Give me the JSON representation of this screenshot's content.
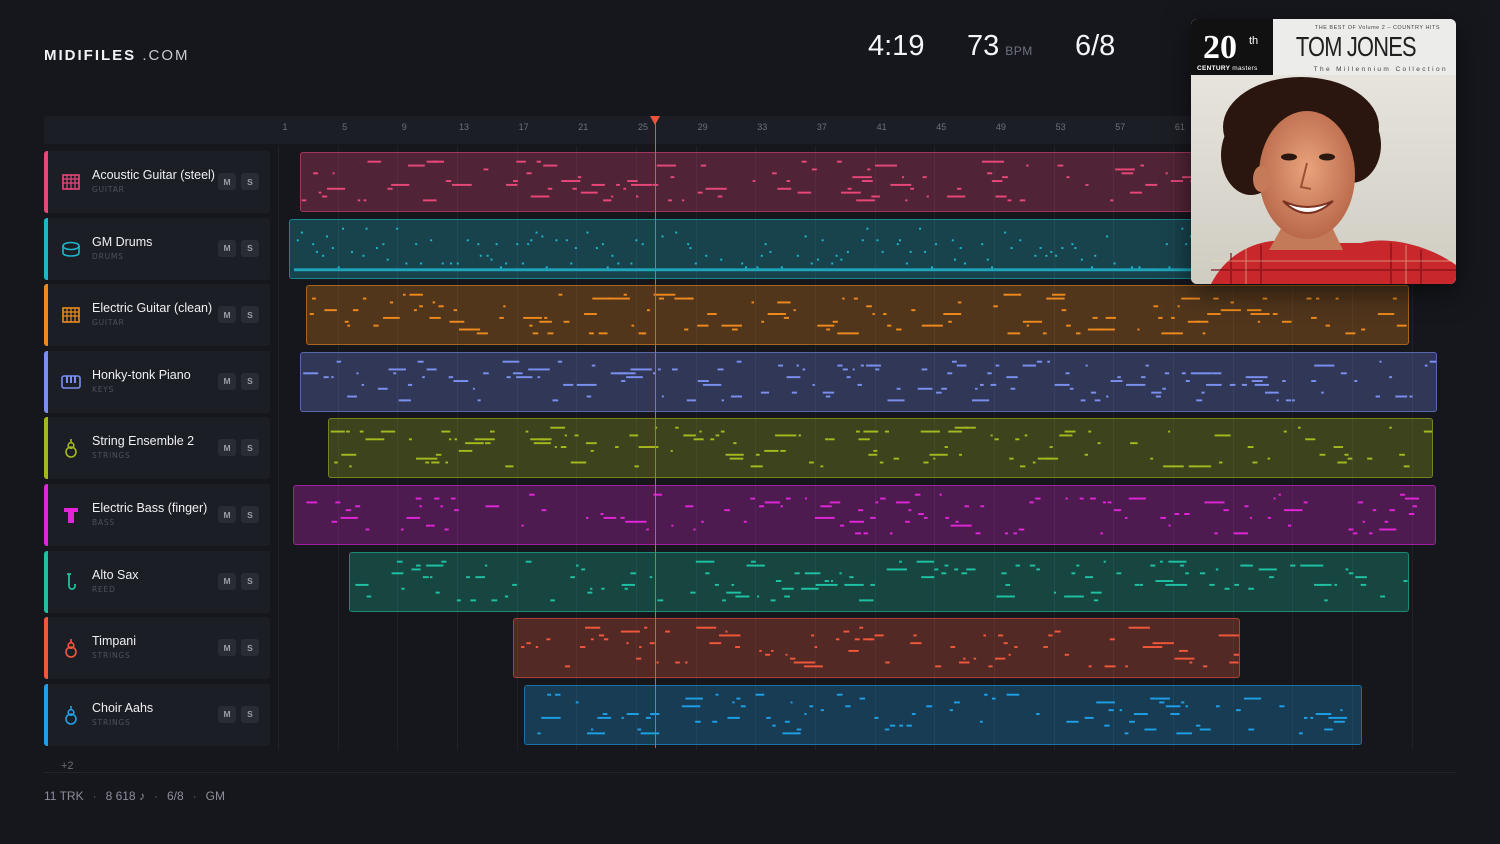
{
  "brand": {
    "main": "MIDIFILES",
    "suffix": ".COM"
  },
  "stats": {
    "time": "4:19",
    "tempo": "73",
    "tempo_unit": "BPM",
    "meter": "6/8"
  },
  "ruler_ticks": [
    "1",
    "5",
    "9",
    "13",
    "17",
    "21",
    "25",
    "29",
    "33",
    "37",
    "41",
    "45",
    "49",
    "53",
    "57",
    "61"
  ],
  "tracks": [
    {
      "name": "Acoustic Guitar (steel)",
      "category": "GUITAR",
      "color": "#e8477a",
      "icon": "guitar-icon",
      "mute": "M",
      "solo": "S"
    },
    {
      "name": "GM Drums",
      "category": "DRUMS",
      "color": "#1fb6cc",
      "icon": "drum-icon",
      "mute": "M",
      "solo": "S"
    },
    {
      "name": "Electric Guitar (clean)",
      "category": "GUITAR",
      "color": "#ee8a1d",
      "icon": "guitar-icon",
      "mute": "M",
      "solo": "S"
    },
    {
      "name": "Honky-tonk Piano",
      "category": "KEYS",
      "color": "#7b8ff0",
      "icon": "piano-icon",
      "mute": "M",
      "solo": "S"
    },
    {
      "name": "String Ensemble 2",
      "category": "STRINGS",
      "color": "#a4b81f",
      "icon": "strings-icon",
      "mute": "M",
      "solo": "S"
    },
    {
      "name": "Electric Bass (finger)",
      "category": "BASS",
      "color": "#e026d7",
      "icon": "bass-icon",
      "mute": "M",
      "solo": "S"
    },
    {
      "name": "Alto Sax",
      "category": "REED",
      "color": "#1ec2a2",
      "icon": "sax-icon",
      "mute": "M",
      "solo": "S"
    },
    {
      "name": "Timpani",
      "category": "STRINGS",
      "color": "#f0583c",
      "icon": "timpani-icon",
      "mute": "M",
      "solo": "S"
    },
    {
      "name": "Choir Aahs",
      "category": "STRINGS",
      "color": "#1e9fe6",
      "icon": "choir-icon",
      "mute": "M",
      "solo": "S"
    }
  ],
  "more_tracks": "+2",
  "footer": {
    "tracks": "11 TRK",
    "notes": "8 618 ♪",
    "meter": "6/8",
    "standard": "GM"
  },
  "album": {
    "badge_number": "20",
    "badge_sup": "th",
    "badge_line_bold": "CENTURY",
    "badge_line_light": "masters",
    "series": "THE BEST OF  Volume 2 – COUNTRY HITS",
    "artist": "TOM JONES",
    "collection": "The Millennium Collection"
  }
}
